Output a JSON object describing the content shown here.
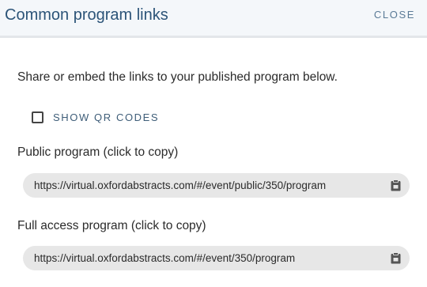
{
  "dialog": {
    "title": "Common program links",
    "close_label": "CLOSE"
  },
  "description": "Share or embed the links to your published program below.",
  "qr_toggle": {
    "label": "SHOW QR CODES",
    "checked": false
  },
  "links": [
    {
      "label": "Public program (click to copy)",
      "url": "https://virtual.oxfordabstracts.com/#/event/public/350/program",
      "icon": "clipboard-icon"
    },
    {
      "label": "Full access program (click to copy)",
      "url": "https://virtual.oxfordabstracts.com/#/event/350/program",
      "icon": "clipboard-icon"
    }
  ],
  "colors": {
    "header_bg": "#f4f7fa",
    "title": "#2c5478",
    "accent_text": "#5a7a96",
    "pill_bg": "#e7e7e7"
  }
}
